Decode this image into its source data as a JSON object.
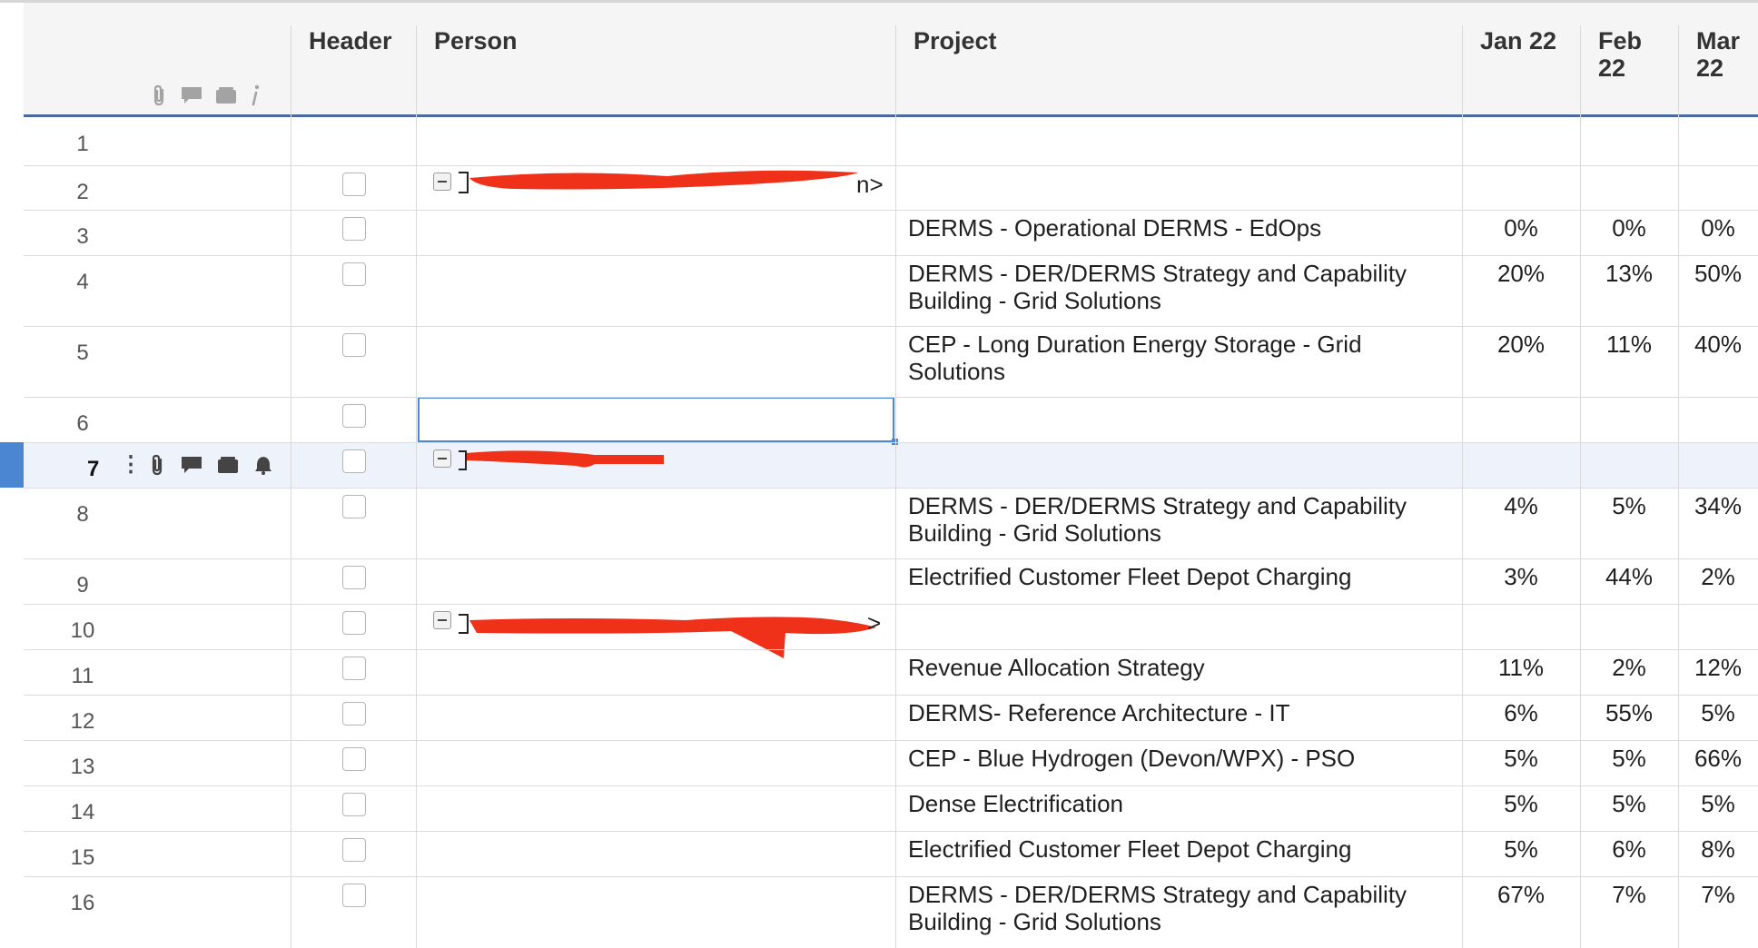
{
  "columns": {
    "header": "Header",
    "person": "Person",
    "project": "Project",
    "jan": "Jan 22",
    "feb": "Feb 22",
    "mar": "Mar 22"
  },
  "header_icons": [
    "paperclip-icon",
    "comment-icon",
    "card-icon",
    "info-icon"
  ],
  "active_row_icons": [
    "paperclip-icon",
    "comment-icon",
    "card-icon",
    "bell-icon"
  ],
  "active_row": 7,
  "selected_cell": {
    "row": 6,
    "column": "Person"
  },
  "person_fragments": {
    "row2_tail": "n>",
    "row10_tail": ">"
  },
  "rows": [
    {
      "num": "1",
      "project": "",
      "jan": "",
      "feb": "",
      "mar": ""
    },
    {
      "num": "2",
      "project": "",
      "jan": "",
      "feb": "",
      "mar": ""
    },
    {
      "num": "3",
      "project": "DERMS - Operational DERMS - EdOps",
      "jan": "0%",
      "feb": "0%",
      "mar": "0%"
    },
    {
      "num": "4",
      "project": "DERMS - DER/DERMS Strategy and Capability Building - Grid Solutions",
      "jan": "20%",
      "feb": "13%",
      "mar": "50%"
    },
    {
      "num": "5",
      "project": "CEP - Long Duration Energy Storage - Grid Solutions",
      "jan": "20%",
      "feb": "11%",
      "mar": "40%"
    },
    {
      "num": "6",
      "project": "",
      "jan": "",
      "feb": "",
      "mar": ""
    },
    {
      "num": "7",
      "project": "",
      "jan": "",
      "feb": "",
      "mar": ""
    },
    {
      "num": "8",
      "project": "DERMS - DER/DERMS Strategy and Capability Building - Grid Solutions",
      "jan": "4%",
      "feb": "5%",
      "mar": "34%"
    },
    {
      "num": "9",
      "project": "Electrified Customer Fleet Depot Charging",
      "jan": "3%",
      "feb": "44%",
      "mar": "2%"
    },
    {
      "num": "10",
      "project": "",
      "jan": "",
      "feb": "",
      "mar": ""
    },
    {
      "num": "11",
      "project": "Revenue Allocation Strategy",
      "jan": "11%",
      "feb": "2%",
      "mar": "12%"
    },
    {
      "num": "12",
      "project": "DERMS- Reference Architecture - IT",
      "jan": "6%",
      "feb": "55%",
      "mar": "5%"
    },
    {
      "num": "13",
      "project": "CEP - Blue Hydrogen (Devon/WPX) - PSO",
      "jan": "5%",
      "feb": "5%",
      "mar": "66%"
    },
    {
      "num": "14",
      "project": "Dense Electrification",
      "jan": "5%",
      "feb": "5%",
      "mar": "5%"
    },
    {
      "num": "15",
      "project": "Electrified Customer Fleet Depot Charging",
      "jan": "5%",
      "feb": "6%",
      "mar": "8%"
    },
    {
      "num": "16",
      "project": "DERMS - DER/DERMS Strategy and Capability Building - Grid Solutions",
      "jan": "67%",
      "feb": "7%",
      "mar": "7%"
    }
  ],
  "colors": {
    "accent": "#4a86d1",
    "header_rule": "#4a6a9e",
    "redaction": "#f0311a",
    "selected_row_bg": "#eef3fb"
  }
}
